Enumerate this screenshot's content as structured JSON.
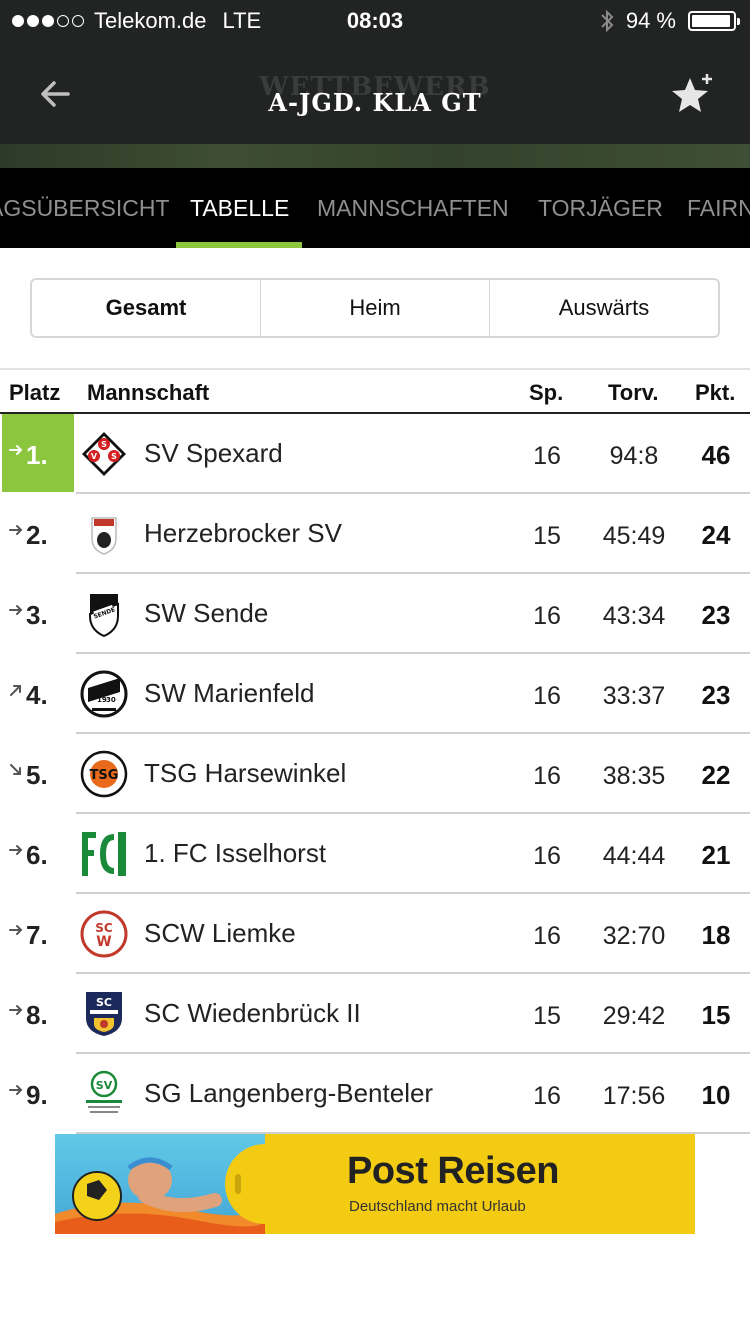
{
  "status_bar": {
    "carrier": "Telekom.de",
    "network": "LTE",
    "time": "08:03",
    "battery": "94 %",
    "battery_level": 0.94,
    "signal_bars_filled": 3,
    "signal_bars_total": 5
  },
  "header": {
    "subtitle": "WETTBEWERB",
    "title": "A-JGD. KLA GT"
  },
  "tabs": [
    {
      "label": "AGSÜBERSICHT",
      "active": false
    },
    {
      "label": "TABELLE",
      "active": true
    },
    {
      "label": "MANNSCHAFTEN",
      "active": false
    },
    {
      "label": "TORJÄGER",
      "active": false
    },
    {
      "label": "FAIRN",
      "active": false
    }
  ],
  "segments": [
    {
      "label": "Gesamt",
      "active": true
    },
    {
      "label": "Heim",
      "active": false
    },
    {
      "label": "Auswärts",
      "active": false
    }
  ],
  "table": {
    "headers": {
      "platz": "Platz",
      "mannschaft": "Mannschaft",
      "sp": "Sp.",
      "torv": "Torv.",
      "pkt": "Pkt."
    },
    "rows": [
      {
        "rank": "1.",
        "trend": "same",
        "team": "SV Spexard",
        "sp": "16",
        "torv": "94:8",
        "pkt": "46",
        "crest": "sv-spexard-crest"
      },
      {
        "rank": "2.",
        "trend": "same",
        "team": "Herzebrocker SV",
        "sp": "15",
        "torv": "45:49",
        "pkt": "24",
        "crest": "herzebrocker-sv-crest"
      },
      {
        "rank": "3.",
        "trend": "same",
        "team": "SW Sende",
        "sp": "16",
        "torv": "43:34",
        "pkt": "23",
        "crest": "sw-sende-crest"
      },
      {
        "rank": "4.",
        "trend": "up",
        "team": "SW Marienfeld",
        "sp": "16",
        "torv": "33:37",
        "pkt": "23",
        "crest": "sw-marienfeld-crest"
      },
      {
        "rank": "5.",
        "trend": "down",
        "team": "TSG Harsewinkel",
        "sp": "16",
        "torv": "38:35",
        "pkt": "22",
        "crest": "tsg-harsewinkel-crest"
      },
      {
        "rank": "6.",
        "trend": "same",
        "team": "1. FC Isselhorst",
        "sp": "16",
        "torv": "44:44",
        "pkt": "21",
        "crest": "fc-isselhorst-crest"
      },
      {
        "rank": "7.",
        "trend": "same",
        "team": "SCW Liemke",
        "sp": "16",
        "torv": "32:70",
        "pkt": "18",
        "crest": "scw-liemke-crest"
      },
      {
        "rank": "8.",
        "trend": "same",
        "team": "SC Wiedenbrück II",
        "sp": "15",
        "torv": "29:42",
        "pkt": "15",
        "crest": "sc-wiedenbrueck-crest"
      },
      {
        "rank": "9.",
        "trend": "same",
        "team": "SG Langenberg-Benteler",
        "sp": "16",
        "torv": "17:56",
        "pkt": "10",
        "crest": "sg-langenberg-crest"
      }
    ]
  },
  "ad": {
    "title": "Post Reisen",
    "subtitle": "Deutschland macht Urlaub"
  },
  "colors": {
    "accent": "#8cc63f",
    "header_bg": "#222423",
    "tabs_bg": "#000000",
    "ad_bg": "#f3cb12"
  }
}
